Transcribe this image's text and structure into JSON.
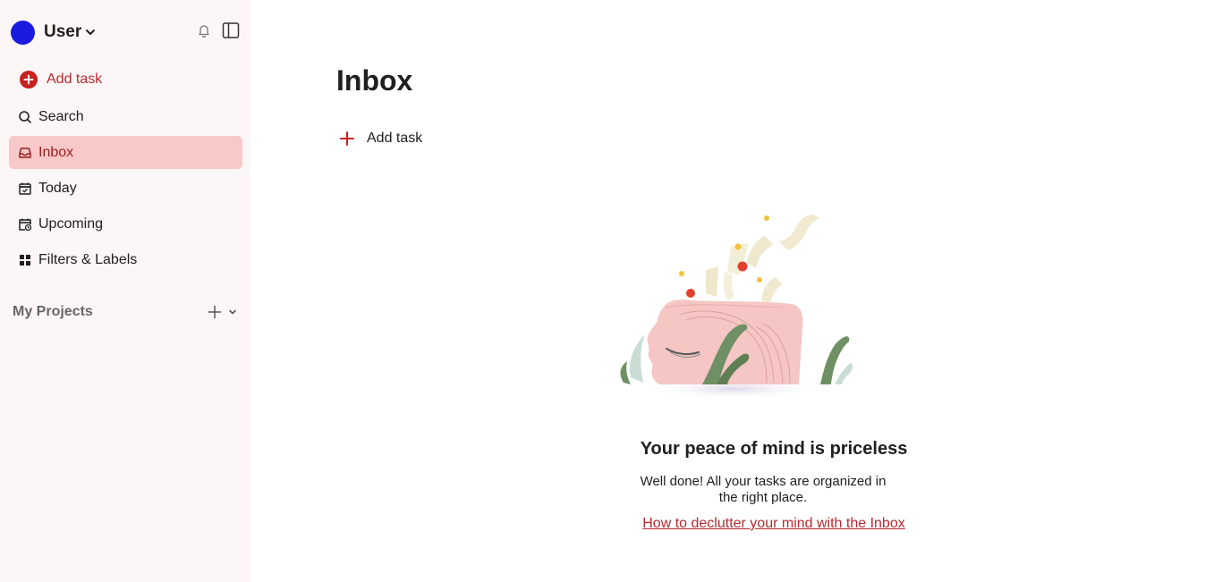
{
  "sidebar": {
    "user": {
      "name": "User",
      "avatar_color": "#1b1be0"
    },
    "icons": {
      "notifications": "bell-icon",
      "toggle": "sidebar-toggle-icon"
    },
    "add_task": "Add task",
    "items": [
      {
        "label": "Search",
        "icon": "search-icon"
      },
      {
        "label": "Inbox",
        "icon": "inbox-icon",
        "active": true
      },
      {
        "label": "Today",
        "icon": "calendar-today-icon"
      },
      {
        "label": "Upcoming",
        "icon": "calendar-upcoming-icon"
      },
      {
        "label": "Filters & Labels",
        "icon": "grid-icon"
      }
    ],
    "projects_label": "My Projects"
  },
  "main": {
    "title": "Inbox",
    "add_task": "Add task",
    "empty_state": {
      "title": "Your peace of mind is priceless",
      "description": "Well done! All your tasks are organized in the right place.",
      "link": "How to declutter your mind with the Inbox"
    }
  },
  "colors": {
    "accent": "#b8292f",
    "sidebar_bg": "#fcf7f6",
    "active_bg": "#f8c9c8",
    "active_text": "#9b1c1c"
  }
}
